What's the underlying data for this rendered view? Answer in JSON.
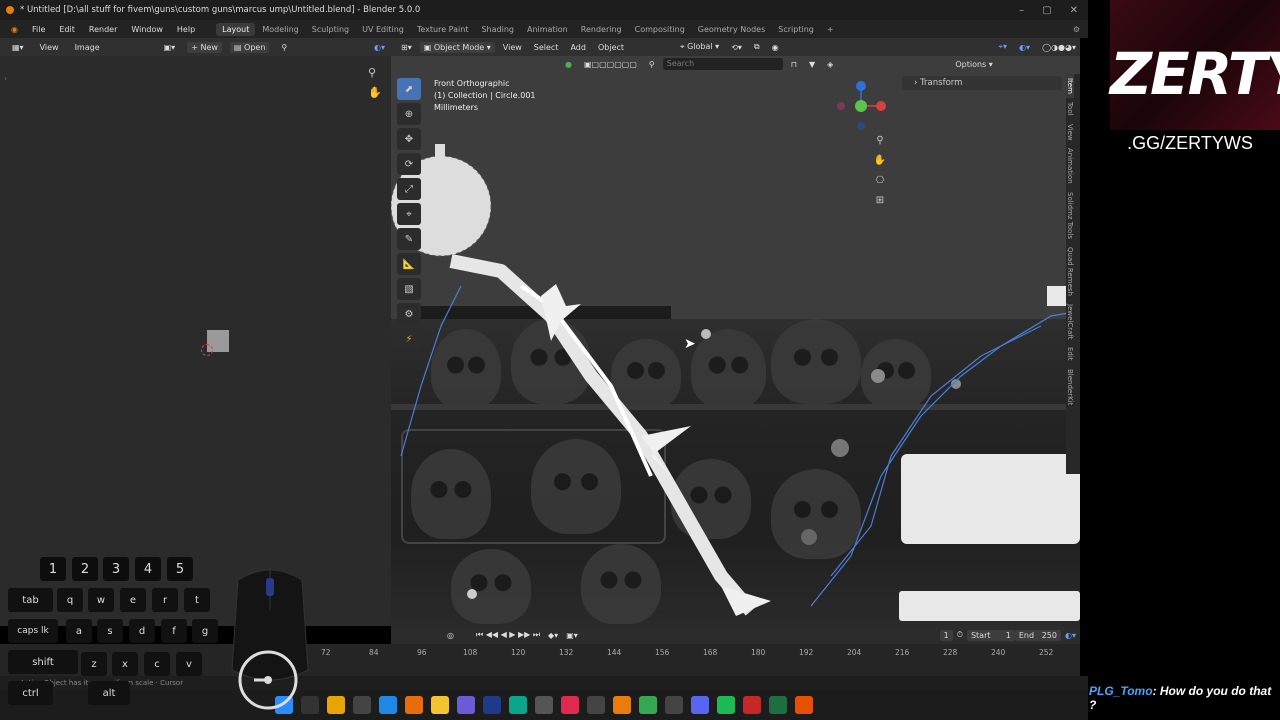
{
  "window": {
    "title": "* Untitled [D:\\all stuff for fivem\\guns\\custom guns\\marcus ump\\Untitled.blend] - Blender 5.0.0"
  },
  "menu": [
    "File",
    "Edit",
    "Render",
    "Window",
    "Help"
  ],
  "workspaces": [
    {
      "label": "Layout",
      "active": true
    },
    {
      "label": "Modeling"
    },
    {
      "label": "Sculpting"
    },
    {
      "label": "UV Editing"
    },
    {
      "label": "Texture Paint"
    },
    {
      "label": "Shading"
    },
    {
      "label": "Animation"
    },
    {
      "label": "Rendering"
    },
    {
      "label": "Compositing"
    },
    {
      "label": "Geometry Nodes"
    },
    {
      "label": "Scripting"
    }
  ],
  "image_editor": {
    "view": "View",
    "image": "Image",
    "new": "New",
    "open": "Open"
  },
  "viewport": {
    "mode": "Object Mode",
    "view": "View",
    "select": "Select",
    "add": "Add",
    "object": "Object",
    "orientation": "Global",
    "search_placeholder": "Search",
    "options": "Options",
    "overlay_line1": "Front Orthographic",
    "overlay_line2": "(1) Collection | Circle.001",
    "overlay_line3": "Millimeters",
    "transform": "Transform",
    "side_tabs": [
      "Item",
      "Tool",
      "View",
      "Animation",
      "Solidmz Tools",
      "Quad Remesh",
      "JewelCraft",
      "Edit",
      "BlenderKit"
    ]
  },
  "timeline": {
    "current_frame": "1",
    "start_label": "Start",
    "start": "1",
    "end_label": "End",
    "end": "250",
    "ticks": [
      "72",
      "84",
      "96",
      "108",
      "120",
      "132",
      "144",
      "156",
      "168",
      "180",
      "192",
      "204",
      "216",
      "228",
      "240",
      "252"
    ]
  },
  "statusbar": "Active Object has item · uniform scale · Cursor",
  "keys": {
    "numbers": [
      "1",
      "2",
      "3",
      "4",
      "5"
    ],
    "row1": [
      "tab",
      "q",
      "w",
      "e",
      "r",
      "t"
    ],
    "row2": [
      "caps lk",
      "a",
      "s",
      "d",
      "f",
      "g"
    ],
    "row3": [
      "shift",
      "z",
      "x",
      "c",
      "v"
    ],
    "row4": [
      "ctrl",
      "alt"
    ]
  },
  "stream": {
    "banner": "ZERTY",
    "link": ".GG/ZERTYWS",
    "chat_user": "PLG_Tomo",
    "chat_msg": ": How do you do that ?"
  },
  "taskbar": [
    {
      "name": "windows",
      "color": "#2a8cff"
    },
    {
      "name": "notion",
      "color": "#333"
    },
    {
      "name": "chrome",
      "color": "#e8a400"
    },
    {
      "name": "store",
      "color": "#444"
    },
    {
      "name": "vscode",
      "color": "#1e88e5"
    },
    {
      "name": "blender-alt",
      "color": "#e86b0c"
    },
    {
      "name": "explorer",
      "color": "#f4c430"
    },
    {
      "name": "obs",
      "color": "#6b5bd6"
    },
    {
      "name": "photoshop",
      "color": "#1e3a8a"
    },
    {
      "name": "app3",
      "color": "#0aa58a"
    },
    {
      "name": "settings",
      "color": "#555"
    },
    {
      "name": "affinity",
      "color": "#e02a4d"
    },
    {
      "name": "app-a",
      "color": "#444"
    },
    {
      "name": "blender",
      "color": "#e87d0d"
    },
    {
      "name": "chrome2",
      "color": "#34a853"
    },
    {
      "name": "app-b",
      "color": "#444"
    },
    {
      "name": "discord",
      "color": "#5865f2"
    },
    {
      "name": "spotify",
      "color": "#1db954"
    },
    {
      "name": "app-c",
      "color": "#c62828"
    },
    {
      "name": "excel",
      "color": "#1d6f42"
    },
    {
      "name": "app-d",
      "color": "#e65100"
    }
  ]
}
